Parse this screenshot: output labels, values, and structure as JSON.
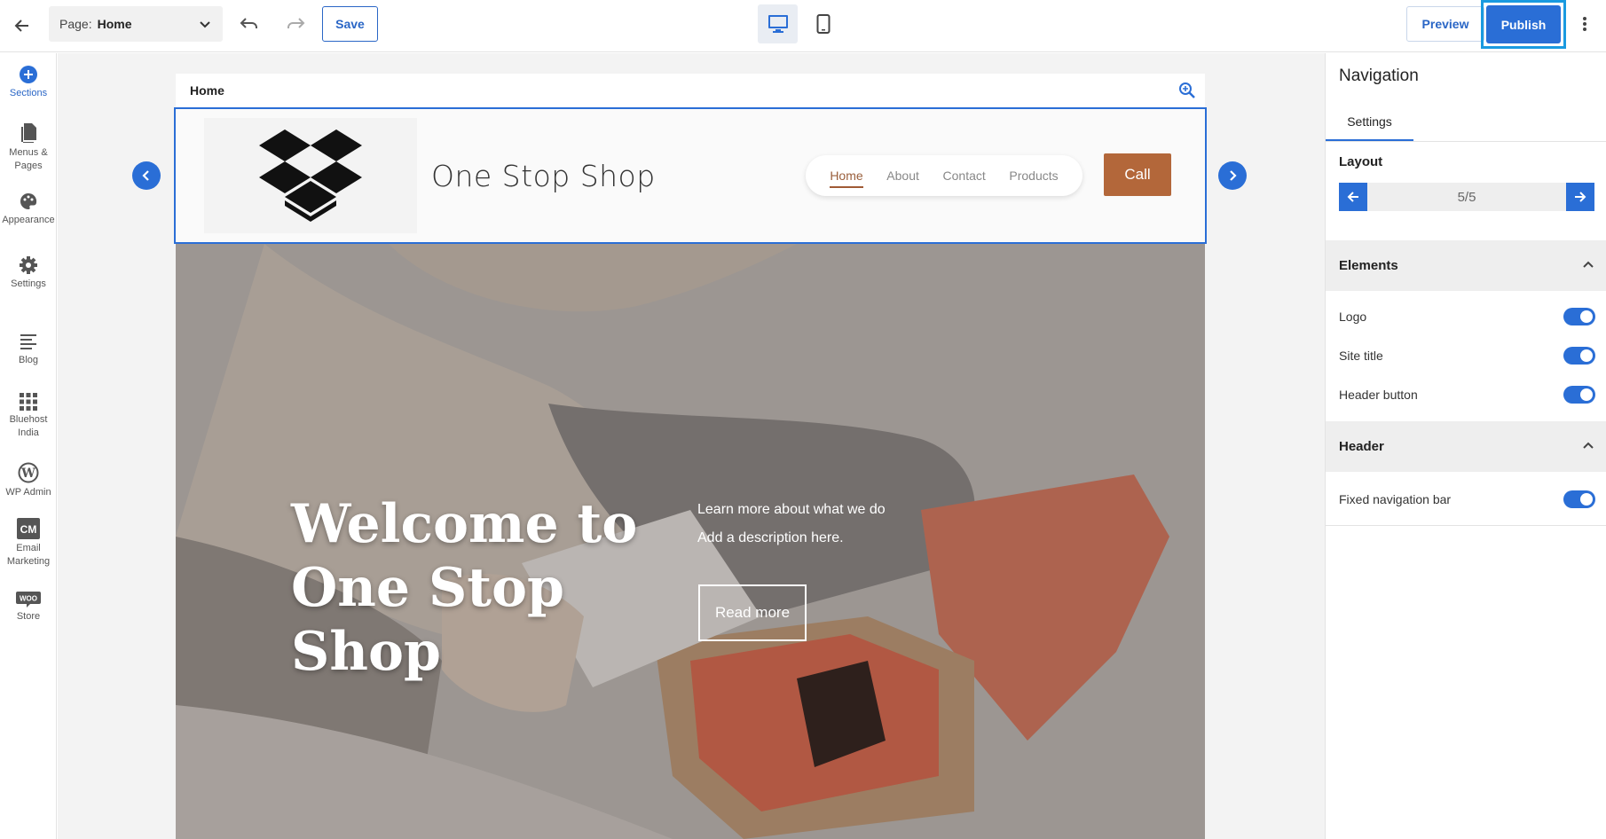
{
  "topbar": {
    "page_label": "Page:",
    "page_value": "Home",
    "save_label": "Save",
    "preview_label": "Preview",
    "publish_label": "Publish"
  },
  "sidebar": {
    "items": [
      {
        "label": "Sections",
        "icon": "plus-circle-icon"
      },
      {
        "label": "Menus &",
        "label2": "Pages",
        "icon": "pages-icon"
      },
      {
        "label": "Appearance",
        "icon": "palette-icon"
      },
      {
        "label": "Settings",
        "icon": "gear-icon"
      },
      {
        "label": "Blog",
        "icon": "blog-icon"
      },
      {
        "label": "Bluehost",
        "label2": "India",
        "icon": "grid-icon"
      },
      {
        "label": "WP Admin",
        "icon": "wordpress-icon"
      },
      {
        "label": "Email",
        "label2": "Marketing",
        "icon": "cm-icon"
      },
      {
        "label": "Store",
        "icon": "woo-icon"
      }
    ]
  },
  "site": {
    "tab_label": "Home",
    "title": "One Stop Shop",
    "nav": [
      "Home",
      "About",
      "Contact",
      "Products"
    ],
    "call_label": "Call",
    "hero_title_1": "Welcome to",
    "hero_title_2": "One Stop Shop",
    "hero_desc_1": "Learn more about what we do",
    "hero_desc_2": "Add a description here.",
    "read_more": "Read more"
  },
  "panel": {
    "title": "Navigation",
    "tab": "Settings",
    "layout_label": "Layout",
    "layout_value": "5/5",
    "elements_label": "Elements",
    "elements": [
      {
        "label": "Logo",
        "on": true
      },
      {
        "label": "Site title",
        "on": true
      },
      {
        "label": "Header button",
        "on": true
      }
    ],
    "header_label": "Header",
    "header_rows": [
      {
        "label": "Fixed navigation bar",
        "on": true
      }
    ]
  },
  "colors": {
    "accent": "#2a6ed6",
    "publish_highlight": "#1a9ae0",
    "call_button": "#b3673a"
  }
}
